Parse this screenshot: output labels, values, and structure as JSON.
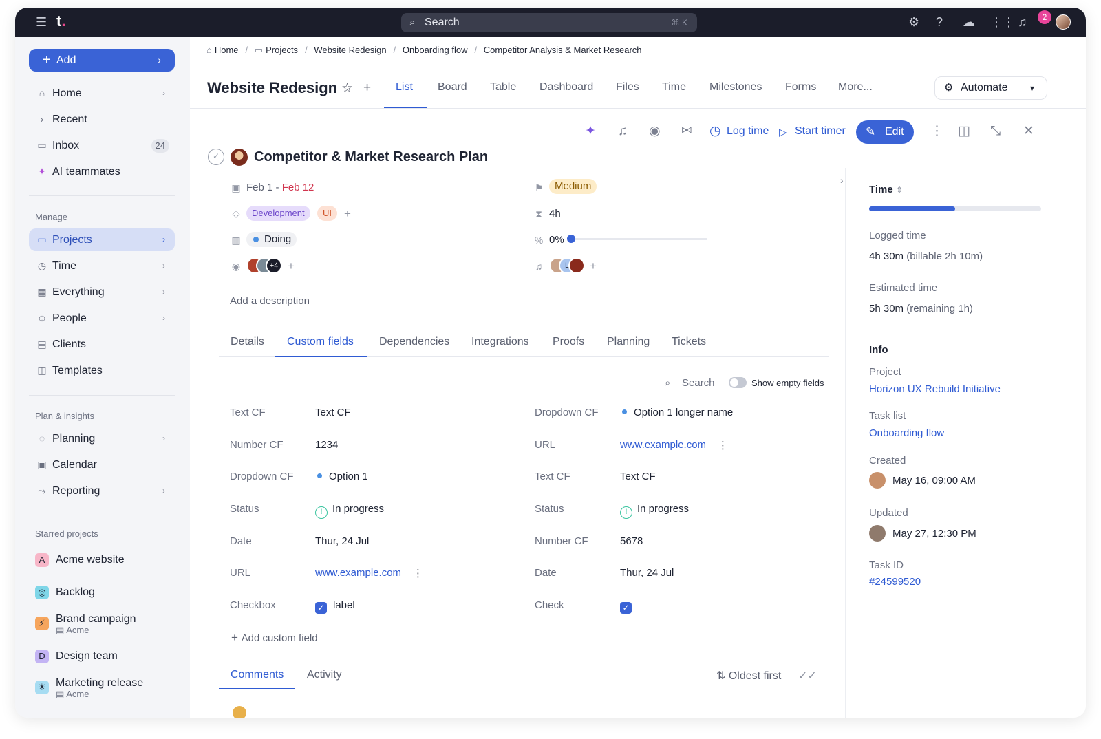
{
  "topbar": {
    "logo": "t",
    "logo_dot": ".",
    "search_placeholder": "Search",
    "search_shortcut": "⌘ K",
    "notification_count": "2"
  },
  "sidebar": {
    "add_label": "Add",
    "nav": [
      {
        "label": "Home"
      },
      {
        "label": "Recent"
      },
      {
        "label": "Inbox",
        "count": "24"
      },
      {
        "label": "AI teammates"
      }
    ],
    "manage_label": "Manage",
    "manage": [
      {
        "label": "Projects"
      },
      {
        "label": "Time"
      },
      {
        "label": "Everything"
      },
      {
        "label": "People"
      },
      {
        "label": "Clients"
      },
      {
        "label": "Templates"
      }
    ],
    "plan_label": "Plan & insights",
    "plan": [
      {
        "label": "Planning"
      },
      {
        "label": "Calendar"
      },
      {
        "label": "Reporting"
      }
    ],
    "starred_label": "Starred projects",
    "starred": [
      {
        "letter": "A",
        "name": "Acme website",
        "sub": "",
        "color": "#f7b6c8"
      },
      {
        "letter": "",
        "name": "Backlog",
        "sub": "",
        "color": "#7fd6e8"
      },
      {
        "letter": "",
        "name": "Brand campaign",
        "sub": "Acme",
        "color": "#f6a55d"
      },
      {
        "letter": "D",
        "name": "Design team",
        "sub": "",
        "color": "#c3b4f4"
      },
      {
        "letter": "",
        "name": "Marketing release",
        "sub": "Acme",
        "color": "#a6dcf2"
      }
    ]
  },
  "breadcrumb": [
    "Home",
    "Projects",
    "Website Redesign",
    "Onboarding flow",
    "Competitor Analysis & Market Research"
  ],
  "project": {
    "title": "Website Redesign",
    "tabs": [
      "List",
      "Board",
      "Table",
      "Dashboard",
      "Files",
      "Time",
      "Milestones",
      "Forms",
      "More..."
    ],
    "automate_label": "Automate"
  },
  "toolbar": {
    "log_time": "Log time",
    "start_timer": "Start timer",
    "edit": "Edit"
  },
  "task": {
    "title": "Competitor & Market Research Plan",
    "date_start": "Feb 1",
    "date_sep": " - ",
    "date_end": "Feb 12",
    "priority": "Medium",
    "tags": [
      "Development",
      "UI"
    ],
    "estimate": "4h",
    "status": "Doing",
    "progress_text": "0%",
    "progress": 0,
    "followers_extra": "+4",
    "assignee_initial": "L",
    "description_placeholder": "Add a description"
  },
  "subtabs": [
    "Details",
    "Custom fields",
    "Dependencies",
    "Integrations",
    "Proofs",
    "Planning",
    "Tickets"
  ],
  "custom_fields": {
    "search_label": "Search",
    "show_empty_label": "Show empty fields",
    "left": [
      {
        "label": "Text CF",
        "value": "Text CF"
      },
      {
        "label": "Number CF",
        "value": "1234"
      },
      {
        "label": "Dropdown CF",
        "value": "Option 1"
      },
      {
        "label": "Status",
        "value": "In progress"
      },
      {
        "label": "Date",
        "value": "Thur, 24 Jul"
      },
      {
        "label": "URL",
        "value": "www.example.com"
      },
      {
        "label": "Checkbox",
        "value": "label"
      }
    ],
    "right": [
      {
        "label": "Dropdown CF",
        "value": "Option 1 longer name"
      },
      {
        "label": "URL",
        "value": "www.example.com"
      },
      {
        "label": "Text CF",
        "value": "Text CF"
      },
      {
        "label": "Status",
        "value": "In progress"
      },
      {
        "label": "Number CF",
        "value": "5678"
      },
      {
        "label": "Date",
        "value": "Thur, 24 Jul"
      },
      {
        "label": "Check",
        "value": ""
      }
    ],
    "add_label": "Add custom field"
  },
  "comments": {
    "tabs": [
      "Comments",
      "Activity"
    ],
    "sort_label": "Oldest first"
  },
  "right_panel": {
    "time_label": "Time",
    "time_progress": 0.5,
    "logged_label": "Logged time",
    "logged_value": "4h 30m",
    "logged_extra": "(billable 2h 10m)",
    "estimated_label": "Estimated time",
    "estimated_value": "5h 30m",
    "estimated_extra": "(remaining 1h)",
    "info_label": "Info",
    "project_label": "Project",
    "project_value": "Horizon UX Rebuild Initiative",
    "tasklist_label": "Task list",
    "tasklist_value": "Onboarding flow",
    "created_label": "Created",
    "created_value": "May 16, 09:00 AM",
    "updated_label": "Updated",
    "updated_value": "May 27, 12:30 PM",
    "taskid_label": "Task ID",
    "taskid_value": "#24599520"
  },
  "colors": {
    "accent": "#3a63d6",
    "topbar": "#1b1d2a",
    "date_end": "#d1364f",
    "priority_bg": "#fdecc8",
    "priority_fg": "#8a5a00",
    "tag_dev_bg": "#e6dcfb",
    "tag_dev_fg": "#6a43c9",
    "tag_ui_bg": "#fde1d4",
    "tag_ui_fg": "#d0552a",
    "status_green": "#3cc5a0"
  }
}
